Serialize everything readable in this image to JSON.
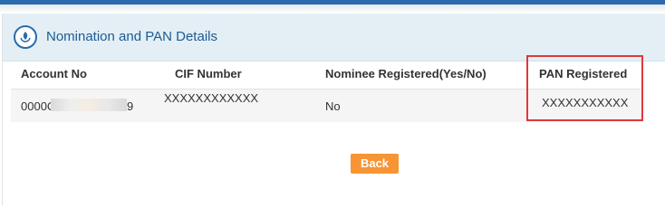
{
  "panel": {
    "title": "Nomination and PAN Details",
    "icon": "nomination-leaf-icon"
  },
  "table": {
    "columns": [
      "Account No",
      "CIF Number",
      "Nominee Registered(Yes/No)",
      "PAN Registered"
    ],
    "rows": [
      {
        "account_prefix": "0000C",
        "account_suffix": "9",
        "cif_number": "XXXXXXXXXXXX",
        "nominee_registered": "No",
        "pan_registered": "XXXXXXXXXXX"
      }
    ]
  },
  "actions": {
    "back_label": "Back"
  },
  "colors": {
    "accent": "#2a6cad",
    "header_bg": "#e3eff5",
    "button": "#f79433",
    "highlight": "#e0383b"
  }
}
